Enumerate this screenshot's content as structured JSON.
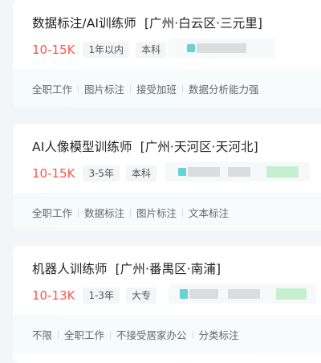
{
  "jobs": [
    {
      "title": "数据标注/AI训练师",
      "location": "[广州·白云区·三元里]",
      "salary": "10-15K",
      "tags": [
        "1年以内",
        "本科"
      ],
      "skills": [
        "全职工作",
        "图片标注",
        "接受加班",
        "数据分析能力强"
      ]
    },
    {
      "title": "AI人像模型训练师",
      "location": "[广州·天河区·天河北]",
      "salary": "10-15K",
      "tags": [
        "3-5年",
        "本科"
      ],
      "skills": [
        "全职工作",
        "数据标注",
        "图片标注",
        "文本标注"
      ]
    },
    {
      "title": "机器人训练师",
      "location": "[广州·番禺区·南浦]",
      "salary": "10-13K",
      "tags": [
        "1-3年",
        "大专"
      ],
      "skills": [
        "不限",
        "全职工作",
        "不接受居家办公",
        "分类标注"
      ]
    }
  ],
  "colors": {
    "salary": "#fe574a",
    "title": "#222222",
    "tag_bg": "#f4f5f6",
    "footer_bg": "#f5fbfb"
  }
}
